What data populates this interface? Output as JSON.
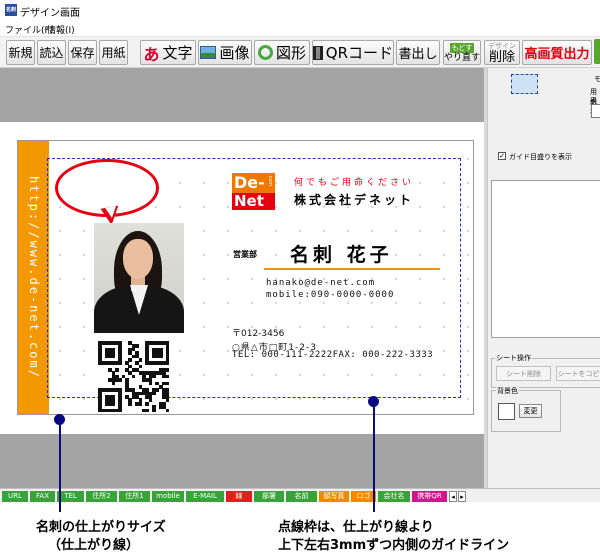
{
  "window": {
    "title": "デザイン画面",
    "app_icon_text": "名刺"
  },
  "menu": [
    "ファイル(F)",
    "情報(I)"
  ],
  "toolbar": {
    "new": "新規",
    "open": "読込",
    "save": "保存",
    "paper": "用紙",
    "text_icon": "あ",
    "text": "文字",
    "image": "画像",
    "shape": "図形",
    "qr": "QRコード",
    "export": "書出し",
    "undo_small": "もどす",
    "redo": "やり直す",
    "delete_small": "デザイン",
    "delete": "削除",
    "print": "高画質出力"
  },
  "card": {
    "vertical_url": "http://www.de-net.com/",
    "logo_top": "De-",
    "logo_bottom": "Net",
    "logo_side": ".com",
    "tagline": "何でもご用命ください",
    "company": "株式会社デネット",
    "department": "営業部",
    "name": "名刺 花子",
    "email": "hanako@de-net.com",
    "mobile": "mobile:090-0000-0000",
    "postal": "〒012-3456",
    "address": "○県△市□町1-2-3",
    "tel_fax": "TEL: 000-111-2222FAX: 000-222-3333"
  },
  "right_panel": {
    "label_top_1": "モ",
    "label_top_2": "用紙",
    "label_top_3": "表示",
    "guide_checkbox_label": "ガイド目盛りを表示",
    "guide_checked": true,
    "sheet_ops_title": "シート操作",
    "sheet_delete": "シート削除",
    "sheet_copy": "シートをコピ",
    "bg_color_title": "背景色",
    "bg_change": "変更"
  },
  "tags": [
    {
      "label": "URL",
      "color": "green"
    },
    {
      "label": "FAX",
      "color": "green"
    },
    {
      "label": "TEL",
      "color": "green"
    },
    {
      "label": "住所2",
      "color": "green"
    },
    {
      "label": "住所1",
      "color": "green"
    },
    {
      "label": "mobile",
      "color": "green"
    },
    {
      "label": "E-MAIL",
      "color": "green"
    },
    {
      "label": "線",
      "color": "red"
    },
    {
      "label": "部署",
      "color": "green"
    },
    {
      "label": "名前",
      "color": "green"
    },
    {
      "label": "顔写真",
      "color": "orange"
    },
    {
      "label": "ロゴ",
      "color": "orange"
    },
    {
      "label": "会社名",
      "color": "green"
    },
    {
      "label": "携帯QR",
      "color": "magenta"
    }
  ],
  "annotations": {
    "left_line1": "名刺の仕上がりサイズ",
    "left_line2": "（仕上がり線）",
    "right_line1": "点線枠は、仕上がり線より",
    "right_line2": "上下左右3mmずつ内側のガイドライン"
  },
  "colors": {
    "accent_orange": "#f39800",
    "accent_red": "#e60012",
    "guide_blue": "#2b2bd0",
    "marker_navy": "#0a0a80",
    "tag_green": "#3aa23a"
  }
}
